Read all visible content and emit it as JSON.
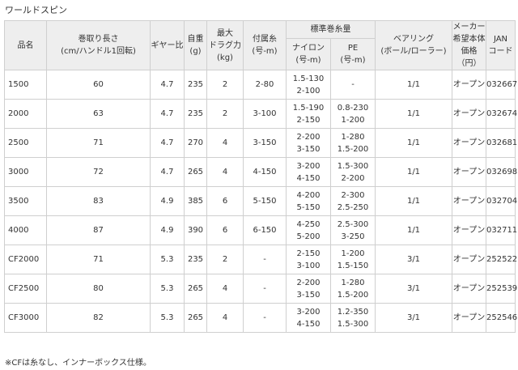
{
  "title": "ワールドスピン",
  "headers": {
    "model": "品名",
    "length_l1": "巻取り長さ",
    "length_l2": "(cm/ハンドル1回転)",
    "gear": "ギヤー比",
    "weight_l1": "自重",
    "weight_l2": "(g)",
    "drag_l1": "最大",
    "drag_l2": "ドラグ力",
    "drag_l3": "(kg)",
    "line_l1": "付属糸",
    "line_l2": "(号-m)",
    "std_line": "標準巻糸量",
    "nylon_l1": "ナイロン",
    "nylon_l2": "(号-m)",
    "pe_l1": "PE",
    "pe_l2": "(号-m)",
    "bearing_l1": "ベアリング",
    "bearing_l2": "(ボール/ローラー)",
    "price_l1": "メーカー",
    "price_l2": "希望本体",
    "price_l3": "価格（円）",
    "jan_l1": "JAN",
    "jan_l2": "コード"
  },
  "rows": [
    {
      "model": "1500",
      "length": "60",
      "gear": "4.7",
      "weight": "235",
      "drag": "2",
      "line": "2-80",
      "nylon1": "1.5-130",
      "nylon2": "2-100",
      "pe1": "-",
      "pe2": "",
      "bearing": "1/1",
      "price": "オープン",
      "jan": "032667"
    },
    {
      "model": "2000",
      "length": "63",
      "gear": "4.7",
      "weight": "235",
      "drag": "2",
      "line": "3-100",
      "nylon1": "1.5-190",
      "nylon2": "2-150",
      "pe1": "0.8-230",
      "pe2": "1-200",
      "bearing": "1/1",
      "price": "オープン",
      "jan": "032674"
    },
    {
      "model": "2500",
      "length": "71",
      "gear": "4.7",
      "weight": "270",
      "drag": "4",
      "line": "3-150",
      "nylon1": "2-200",
      "nylon2": "3-150",
      "pe1": "1-280",
      "pe2": "1.5-200",
      "bearing": "1/1",
      "price": "オープン",
      "jan": "032681"
    },
    {
      "model": "3000",
      "length": "72",
      "gear": "4.7",
      "weight": "265",
      "drag": "4",
      "line": "4-150",
      "nylon1": "3-200",
      "nylon2": "4-150",
      "pe1": "1.5-300",
      "pe2": "2-200",
      "bearing": "1/1",
      "price": "オープン",
      "jan": "032698"
    },
    {
      "model": "3500",
      "length": "83",
      "gear": "4.9",
      "weight": "385",
      "drag": "6",
      "line": "5-150",
      "nylon1": "4-200",
      "nylon2": "5-150",
      "pe1": "2-300",
      "pe2": "2.5-250",
      "bearing": "1/1",
      "price": "オープン",
      "jan": "032704"
    },
    {
      "model": "4000",
      "length": "87",
      "gear": "4.9",
      "weight": "390",
      "drag": "6",
      "line": "6-150",
      "nylon1": "4-250",
      "nylon2": "5-200",
      "pe1": "2.5-300",
      "pe2": "3-250",
      "bearing": "1/1",
      "price": "オープン",
      "jan": "032711"
    },
    {
      "model": "CF2000",
      "length": "71",
      "gear": "5.3",
      "weight": "235",
      "drag": "2",
      "line": "-",
      "nylon1": "2-150",
      "nylon2": "3-100",
      "pe1": "1-200",
      "pe2": "1.5-150",
      "bearing": "3/1",
      "price": "オープン",
      "jan": "252522"
    },
    {
      "model": "CF2500",
      "length": "80",
      "gear": "5.3",
      "weight": "265",
      "drag": "4",
      "line": "-",
      "nylon1": "2-200",
      "nylon2": "3-150",
      "pe1": "1-280",
      "pe2": "1.5-200",
      "bearing": "3/1",
      "price": "オープン",
      "jan": "252539"
    },
    {
      "model": "CF3000",
      "length": "82",
      "gear": "5.3",
      "weight": "265",
      "drag": "4",
      "line": "-",
      "nylon1": "3-200",
      "nylon2": "4-150",
      "pe1": "1.2-350",
      "pe2": "1.5-300",
      "bearing": "3/1",
      "price": "オープン",
      "jan": "252546"
    }
  ],
  "note": "※CFは糸なし、インナーボックス仕様。"
}
